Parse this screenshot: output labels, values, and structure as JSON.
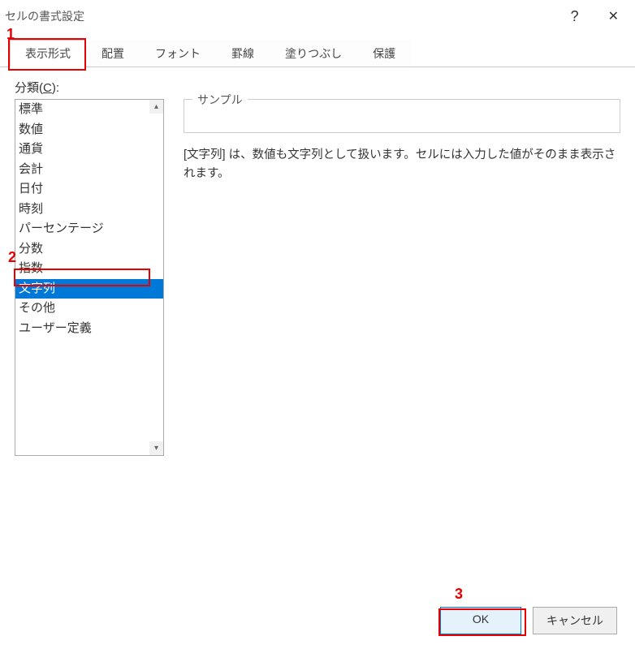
{
  "dialog": {
    "title": "セルの書式設定",
    "help": "?",
    "close": "✕"
  },
  "tabs": [
    {
      "label": "表示形式",
      "active": true
    },
    {
      "label": "配置",
      "active": false
    },
    {
      "label": "フォント",
      "active": false
    },
    {
      "label": "罫線",
      "active": false
    },
    {
      "label": "塗りつぶし",
      "active": false
    },
    {
      "label": "保護",
      "active": false
    }
  ],
  "category": {
    "label_prefix": "分類(",
    "label_key": "C",
    "label_suffix": "):",
    "items": [
      {
        "label": "標準",
        "selected": false
      },
      {
        "label": "数値",
        "selected": false
      },
      {
        "label": "通貨",
        "selected": false
      },
      {
        "label": "会計",
        "selected": false
      },
      {
        "label": "日付",
        "selected": false
      },
      {
        "label": "時刻",
        "selected": false
      },
      {
        "label": "パーセンテージ",
        "selected": false
      },
      {
        "label": "分数",
        "selected": false
      },
      {
        "label": "指数",
        "selected": false
      },
      {
        "label": "文字列",
        "selected": true
      },
      {
        "label": "その他",
        "selected": false
      },
      {
        "label": "ユーザー定義",
        "selected": false
      }
    ]
  },
  "sample": {
    "legend": "サンプル",
    "value": ""
  },
  "description": "[文字列] は、数値も文字列として扱います。セルには入力した値がそのまま表示されます。",
  "buttons": {
    "ok": "OK",
    "cancel": "キャンセル"
  },
  "annotations": {
    "a1": "1",
    "a2": "2",
    "a3": "3"
  }
}
